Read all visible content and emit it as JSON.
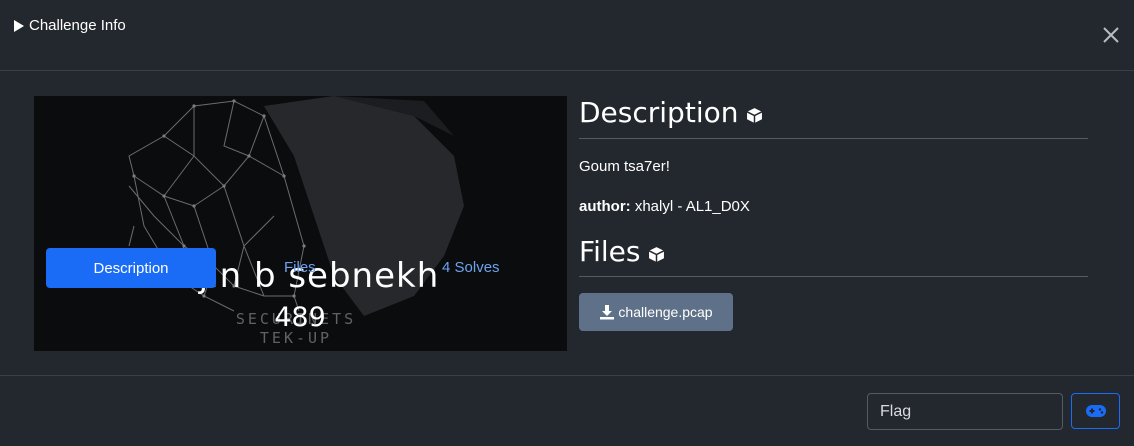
{
  "header": {
    "title": "Challenge Info"
  },
  "challenge": {
    "name": "Tajin b sebnekh",
    "points": "489",
    "tabs": {
      "description": "Description",
      "files": "Files",
      "solves": "4 Solves"
    },
    "banner_logo_line1": "SECURINETS",
    "banner_logo_line2": "TEK-UP"
  },
  "description": {
    "heading": "Description",
    "text": "Goum tsa7er!",
    "author_label": "author:",
    "author_value": " xhalyl - AL1_D0X"
  },
  "files": {
    "heading": "Files",
    "items": [
      {
        "label": "challenge.pcap"
      }
    ]
  },
  "footer": {
    "flag_placeholder": "Flag"
  },
  "colors": {
    "background": "#23272e",
    "primary": "#1a6cf6",
    "link": "#6ea2ef",
    "file_button": "#5f7188"
  },
  "icons": [
    "play-icon",
    "close-icon",
    "cube-icon",
    "download-icon",
    "gamepad-icon"
  ]
}
